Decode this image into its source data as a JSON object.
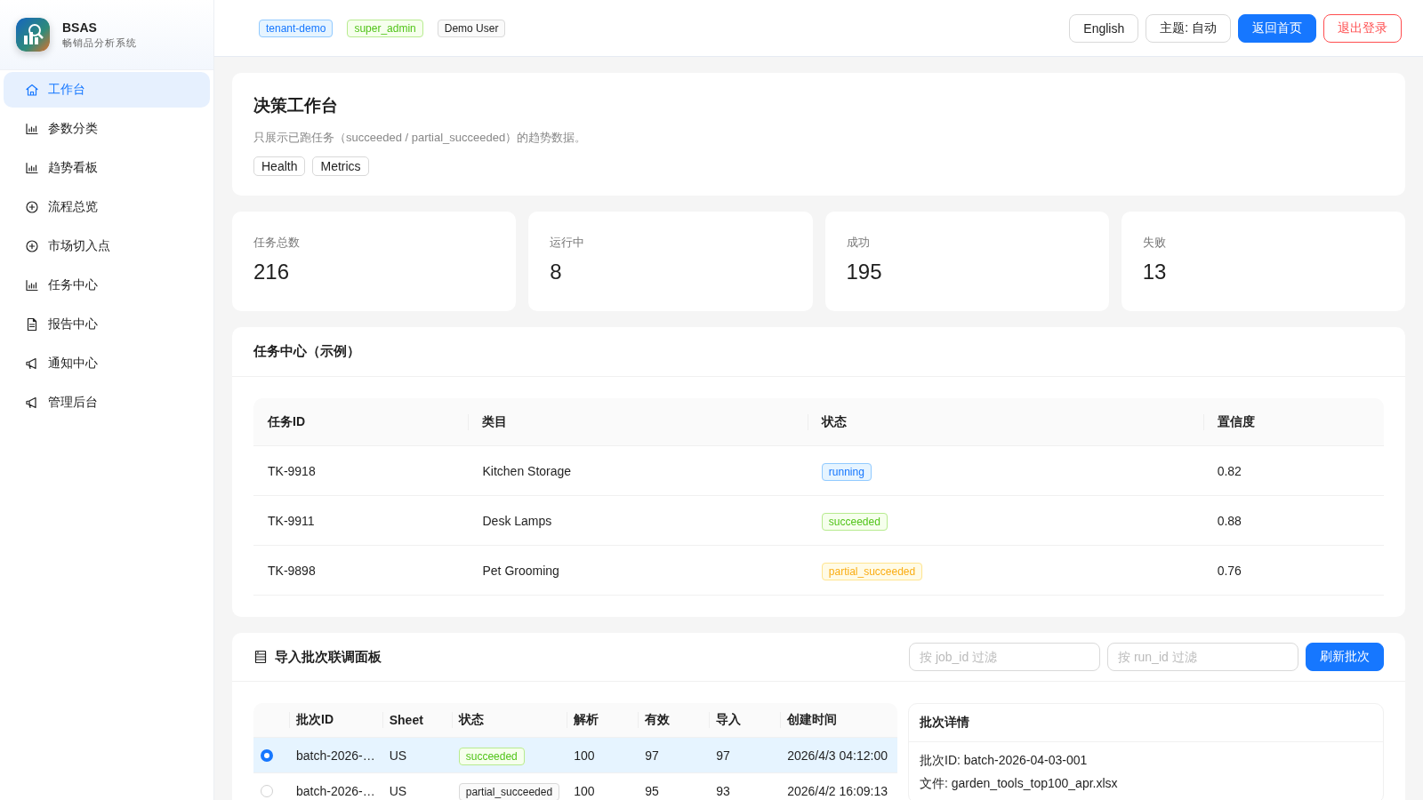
{
  "brand": {
    "name": "BSAS",
    "subtitle": "畅销品分析系统"
  },
  "sidebar": {
    "items": [
      {
        "label": "工作台",
        "selected": true
      },
      {
        "label": "参数分类",
        "selected": false
      },
      {
        "label": "趋势看板",
        "selected": false
      },
      {
        "label": "流程总览",
        "selected": false
      },
      {
        "label": "市场切入点",
        "selected": false
      },
      {
        "label": "任务中心",
        "selected": false
      },
      {
        "label": "报告中心",
        "selected": false
      },
      {
        "label": "通知中心",
        "selected": false
      },
      {
        "label": "管理后台",
        "selected": false
      }
    ]
  },
  "header": {
    "tags": [
      {
        "label": "tenant-demo",
        "kind": "info"
      },
      {
        "label": "super_admin",
        "kind": "success"
      },
      {
        "label": "Demo User",
        "kind": "default"
      }
    ],
    "buttons": [
      {
        "label": "English",
        "kind": "default"
      },
      {
        "label": "主题: 自动",
        "kind": "default"
      },
      {
        "label": "返回首页",
        "kind": "primary"
      },
      {
        "label": "退出登录",
        "kind": "danger"
      }
    ]
  },
  "intro": {
    "title": "决策工作台",
    "description": "只展示已跑任务（succeeded / partial_succeeded）的趋势数据。",
    "tags": [
      "Health",
      "Metrics"
    ]
  },
  "stats": [
    {
      "label": "任务总数",
      "value": "216"
    },
    {
      "label": "运行中",
      "value": "8"
    },
    {
      "label": "成功",
      "value": "195"
    },
    {
      "label": "失败",
      "value": "13"
    }
  ],
  "tasks": {
    "title": "任务中心（示例）",
    "columns": [
      "任务ID",
      "类目",
      "状态",
      "置信度"
    ],
    "rows": [
      {
        "id": "TK-9918",
        "category": "Kitchen Storage",
        "status": {
          "label": "running",
          "kind": "info"
        },
        "confidence": "0.82"
      },
      {
        "id": "TK-9911",
        "category": "Desk Lamps",
        "status": {
          "label": "succeeded",
          "kind": "success"
        },
        "confidence": "0.88"
      },
      {
        "id": "TK-9898",
        "category": "Pet Grooming",
        "status": {
          "label": "partial_succeeded",
          "kind": "warning"
        },
        "confidence": "0.76"
      }
    ]
  },
  "batches": {
    "title": "导入批次联调面板",
    "filters": [
      {
        "placeholder": "按 job_id 过滤"
      },
      {
        "placeholder": "按 run_id 过滤"
      }
    ],
    "refresh_button": "刷新批次",
    "columns": [
      "批次ID",
      "Sheet",
      "状态",
      "解析",
      "有效",
      "导入",
      "创建时间"
    ],
    "rows": [
      {
        "selected": true,
        "id": "batch-2026-…",
        "sheet": "US",
        "status": {
          "label": "succeeded",
          "kind": "success"
        },
        "parsed": "100",
        "valid": "97",
        "imported": "97",
        "created": "2026/4/3 04:12:00"
      },
      {
        "selected": false,
        "id": "batch-2026-…",
        "sheet": "US",
        "status": {
          "label": "partial_succeeded",
          "kind": "default"
        },
        "parsed": "100",
        "valid": "95",
        "imported": "93",
        "created": "2026/4/2 16:09:13"
      }
    ],
    "detail": {
      "title": "批次详情",
      "lines": [
        "批次ID: batch-2026-04-03-001",
        "文件: garden_tools_top100_apr.xlsx"
      ]
    }
  }
}
